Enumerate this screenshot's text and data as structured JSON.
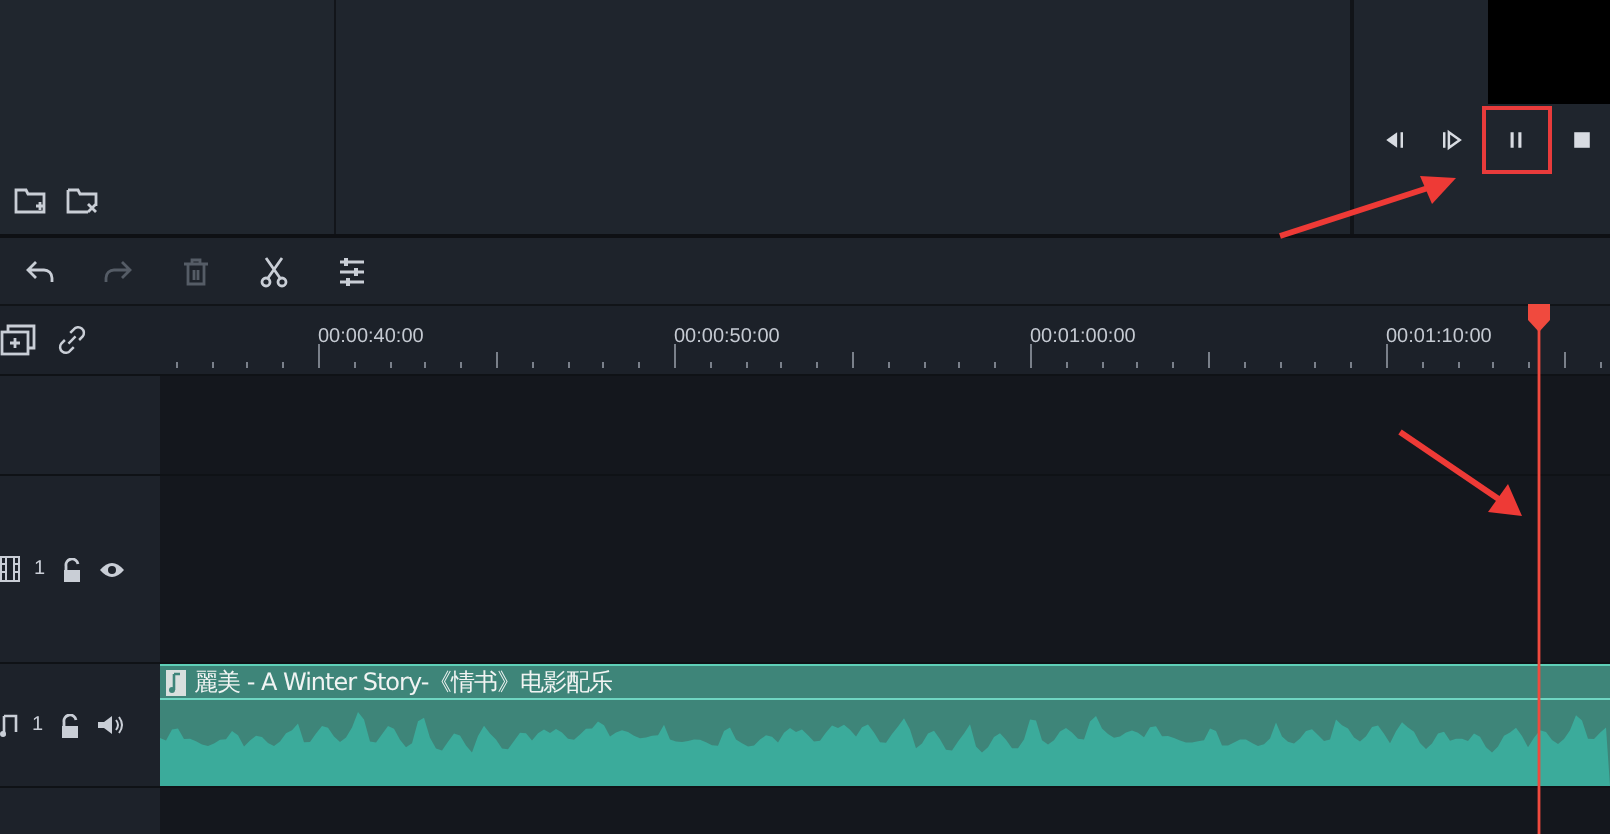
{
  "playback": {
    "buttons": [
      {
        "kind": "prev-frame",
        "highlighted": false
      },
      {
        "kind": "next-frame",
        "highlighted": false
      },
      {
        "kind": "pause",
        "highlighted": true
      },
      {
        "kind": "stop",
        "highlighted": false
      }
    ]
  },
  "toolbar": {
    "items": [
      {
        "kind": "undo",
        "disabled": false
      },
      {
        "kind": "redo",
        "disabled": true
      },
      {
        "kind": "delete",
        "disabled": true
      },
      {
        "kind": "cut",
        "disabled": false
      },
      {
        "kind": "adjust",
        "disabled": false
      }
    ]
  },
  "ruler": {
    "labels": [
      "00:00:40:00",
      "00:00:50:00",
      "00:01:00:00",
      "00:01:10:00"
    ]
  },
  "tracks": [
    {
      "kind": "empty"
    },
    {
      "kind": "video",
      "number": "1",
      "locked": false,
      "visible": true
    },
    {
      "kind": "audio",
      "number": "1",
      "locked": false,
      "muted": false,
      "clip": {
        "title": "麗美 - A Winter Story-《情书》电影配乐"
      }
    }
  ]
}
